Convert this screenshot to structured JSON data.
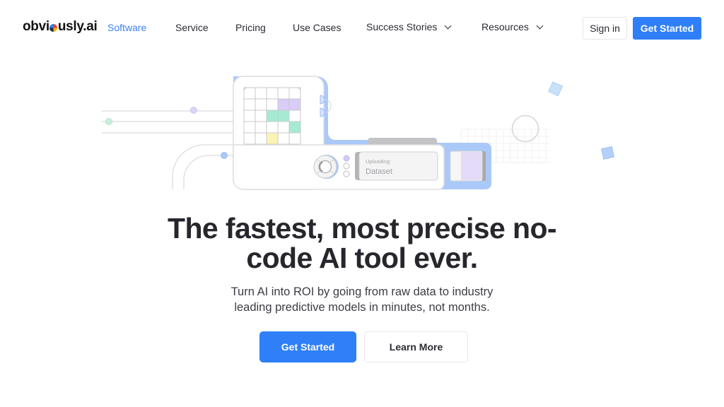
{
  "nav": {
    "logo": {
      "prefix": "obvi",
      "suffix": "usly.ai"
    },
    "items": [
      {
        "label": "Software",
        "active": true,
        "has_dropdown": false
      },
      {
        "label": "Service",
        "active": false,
        "has_dropdown": false
      },
      {
        "label": "Pricing",
        "active": false,
        "has_dropdown": false
      },
      {
        "label": "Use Cases",
        "active": false,
        "has_dropdown": false
      },
      {
        "label": "Success Stories",
        "active": false,
        "has_dropdown": true
      },
      {
        "label": "Resources",
        "active": false,
        "has_dropdown": true
      }
    ],
    "sign_in": "Sign in",
    "get_started": "Get Started"
  },
  "illustration": {
    "upload_status_label": "Uploading:",
    "upload_file_label": "Dataset"
  },
  "hero": {
    "headline_line1": "The fastest, most precise no-",
    "headline_line2": "code AI tool ever.",
    "subline_line1": "Turn AI into ROI by going from raw data to industry",
    "subline_line2": "leading predictive models in minutes, not months.",
    "primary_cta": "Get Started",
    "secondary_cta": "Learn More"
  },
  "colors": {
    "accent": "#2f7ff8",
    "active_nav": "#3b82f6",
    "grid_purple": "#d9ccf7",
    "grid_green": "#a5ead3",
    "grid_yellow": "#fbf4b3",
    "grid_blue": "#aac9f7"
  }
}
